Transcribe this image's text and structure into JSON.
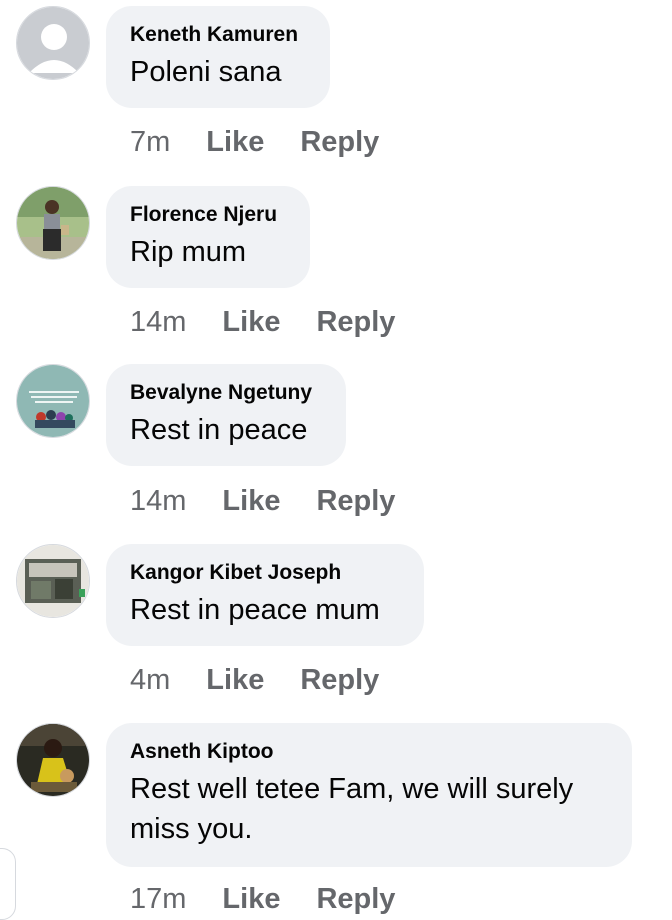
{
  "comments": [
    {
      "author": "Keneth Kamuren",
      "text": "Poleni sana",
      "time": "7m",
      "like": "Like",
      "reply": "Reply"
    },
    {
      "author": "Florence Njeru",
      "text": "Rip mum",
      "time": "14m",
      "like": "Like",
      "reply": "Reply"
    },
    {
      "author": "Bevalyne Ngetuny",
      "text": "Rest in peace",
      "time": "14m",
      "like": "Like",
      "reply": "Reply"
    },
    {
      "author": "Kangor Kibet Joseph",
      "text": "Rest in peace mum",
      "time": "4m",
      "like": "Like",
      "reply": "Reply"
    },
    {
      "author": "Asneth Kiptoo",
      "text": "Rest well tetee Fam, we will surely miss you.",
      "time": "17m",
      "like": "Like",
      "reply": "Reply"
    }
  ],
  "avatar_icons": [
    "default-avatar-icon",
    "person-photo-avatar",
    "quote-image-avatar",
    "house-photo-avatar",
    "person-photo-avatar"
  ],
  "colors": {
    "bubble": "#f0f2f5",
    "meta_text": "#65676b",
    "text": "#050505"
  }
}
